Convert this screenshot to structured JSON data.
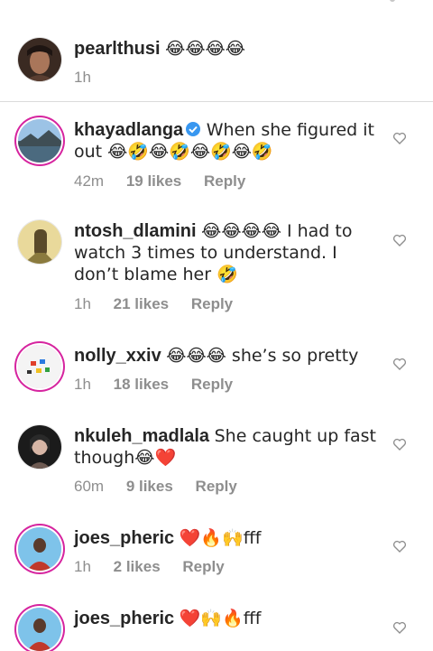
{
  "caption": {
    "username": "pearlthusi",
    "text": "😂😂😂😂",
    "time": "1h"
  },
  "comments": [
    {
      "username": "khayadlanga",
      "verified": true,
      "text": "When she figured it out 😂🤣😂🤣😂🤣😂🤣",
      "time": "42m",
      "likes": "19 likes",
      "reply": "Reply"
    },
    {
      "username": "ntosh_dlamini",
      "verified": false,
      "text": "😂😂😂😂 I had to watch 3 times to understand. I don’t blame her 🤣",
      "time": "1h",
      "likes": "21 likes",
      "reply": "Reply"
    },
    {
      "username": "nolly_xxiv",
      "verified": false,
      "text": "😂😂😂 she’s so pretty",
      "time": "1h",
      "likes": "18 likes",
      "reply": "Reply"
    },
    {
      "username": "nkuleh_madlala",
      "verified": false,
      "text": "She caught up fast though😂❤️",
      "time": "60m",
      "likes": "9 likes",
      "reply": "Reply"
    },
    {
      "username": "joes_pheric",
      "verified": false,
      "text": "❤️🔥🙌fff",
      "time": "1h",
      "likes": "2 likes",
      "reply": "Reply"
    },
    {
      "username": "joes_pheric",
      "verified": false,
      "text": "❤️🙌🔥fff",
      "time": "",
      "likes": "",
      "reply": ""
    }
  ],
  "icons": {
    "like": "heart-outline-icon",
    "verified": "verified-badge-icon"
  },
  "colors": {
    "text": "#262626",
    "meta": "#8e8e8e",
    "verified": "#3897f0",
    "story_ring": "#d6249f"
  }
}
